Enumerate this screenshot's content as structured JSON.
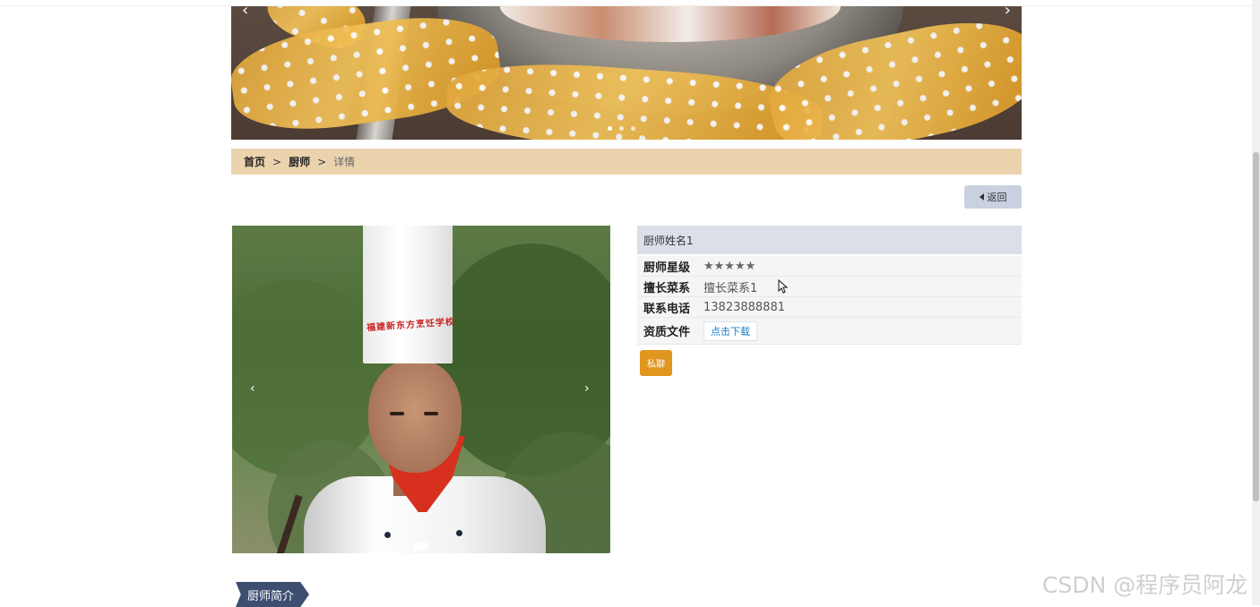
{
  "breadcrumb": {
    "home": "首页",
    "section": "厨师",
    "current": "详情",
    "separator": ">"
  },
  "back_button": {
    "label": "返回"
  },
  "chef": {
    "name": "厨师姓名1",
    "fields": [
      {
        "label": "厨师星级",
        "value": "★★★★★"
      },
      {
        "label": "擅长菜系",
        "value": "擅长菜系1"
      },
      {
        "label": "联系电话",
        "value": "13823888881"
      },
      {
        "label": "资质文件",
        "value": "点击下载"
      }
    ],
    "hat_text": "福建新东方烹饪学校"
  },
  "chat_button": {
    "label": "私聊"
  },
  "section_tag": {
    "label": "厨师简介"
  },
  "watermark": "CSDN @程序员阿龙",
  "photo_arrows": {
    "prev": "‹",
    "next": "›"
  },
  "banner_arrows": {
    "prev": "‹",
    "next": "›"
  }
}
